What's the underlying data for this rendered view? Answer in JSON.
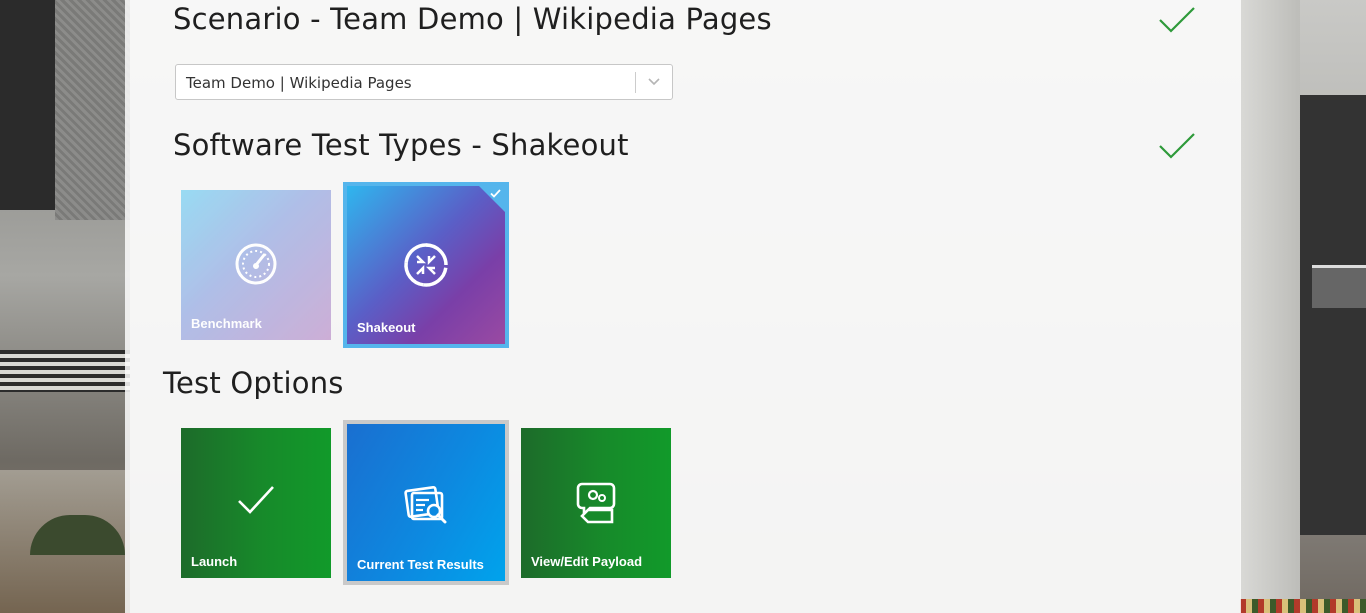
{
  "scenario": {
    "heading": "Scenario - Team Demo | Wikipedia Pages",
    "select_value": "Team Demo | Wikipedia Pages",
    "complete_icon": "checkmark-icon"
  },
  "test_types": {
    "heading": "Software Test Types - Shakeout",
    "complete_icon": "checkmark-icon",
    "tiles": [
      {
        "label": "Benchmark",
        "icon": "speedometer-icon",
        "selected": false
      },
      {
        "label": "Shakeout",
        "icon": "shakeout-arrows-icon",
        "selected": true
      }
    ]
  },
  "test_options": {
    "heading": "Test Options",
    "tiles": [
      {
        "label": "Launch",
        "icon": "checkmark-icon"
      },
      {
        "label": "Current Test Results",
        "icon": "document-search-icon"
      },
      {
        "label": "View/Edit Payload",
        "icon": "settings-chat-icon"
      }
    ]
  },
  "colors": {
    "check_green": "#2e9a3a",
    "selected_border": "#55b5ec",
    "option_green": "#178a2a",
    "option_blue": "#0d89e0"
  }
}
